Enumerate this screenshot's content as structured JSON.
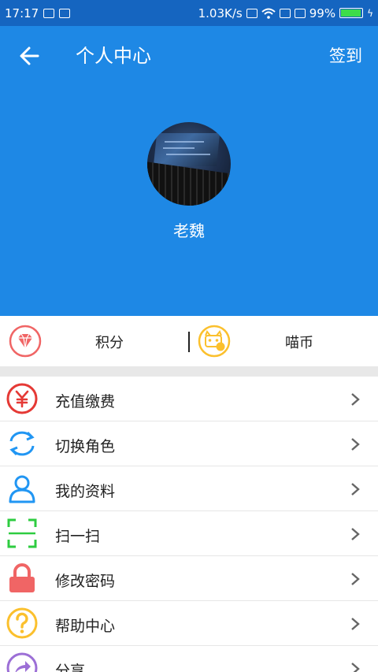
{
  "status_bar": {
    "time": "17:17",
    "speed": "1.03K/s",
    "battery": "99%"
  },
  "header": {
    "title": "个人中心",
    "checkin_label": "签到",
    "username": "老魏"
  },
  "points": {
    "jifen_label": "积分",
    "miaobi_label": "喵币"
  },
  "menu": {
    "items": [
      {
        "label": "充值缴费",
        "icon": "yuan-icon",
        "color": "#e53935"
      },
      {
        "label": "切换角色",
        "icon": "switch-role-icon",
        "color": "#2196f3"
      },
      {
        "label": "我的资料",
        "icon": "profile-icon",
        "color": "#2196f3"
      },
      {
        "label": "扫一扫",
        "icon": "scan-icon",
        "color": "#2ecc40"
      },
      {
        "label": "修改密码",
        "icon": "lock-icon",
        "color": "#f06565"
      },
      {
        "label": "帮助中心",
        "icon": "help-icon",
        "color": "#fbc02d"
      },
      {
        "label": "分享",
        "icon": "share-icon",
        "color": "#9c6fd6"
      }
    ]
  },
  "colors": {
    "header_bg": "#1e88e5",
    "status_bg": "#1565c0"
  }
}
